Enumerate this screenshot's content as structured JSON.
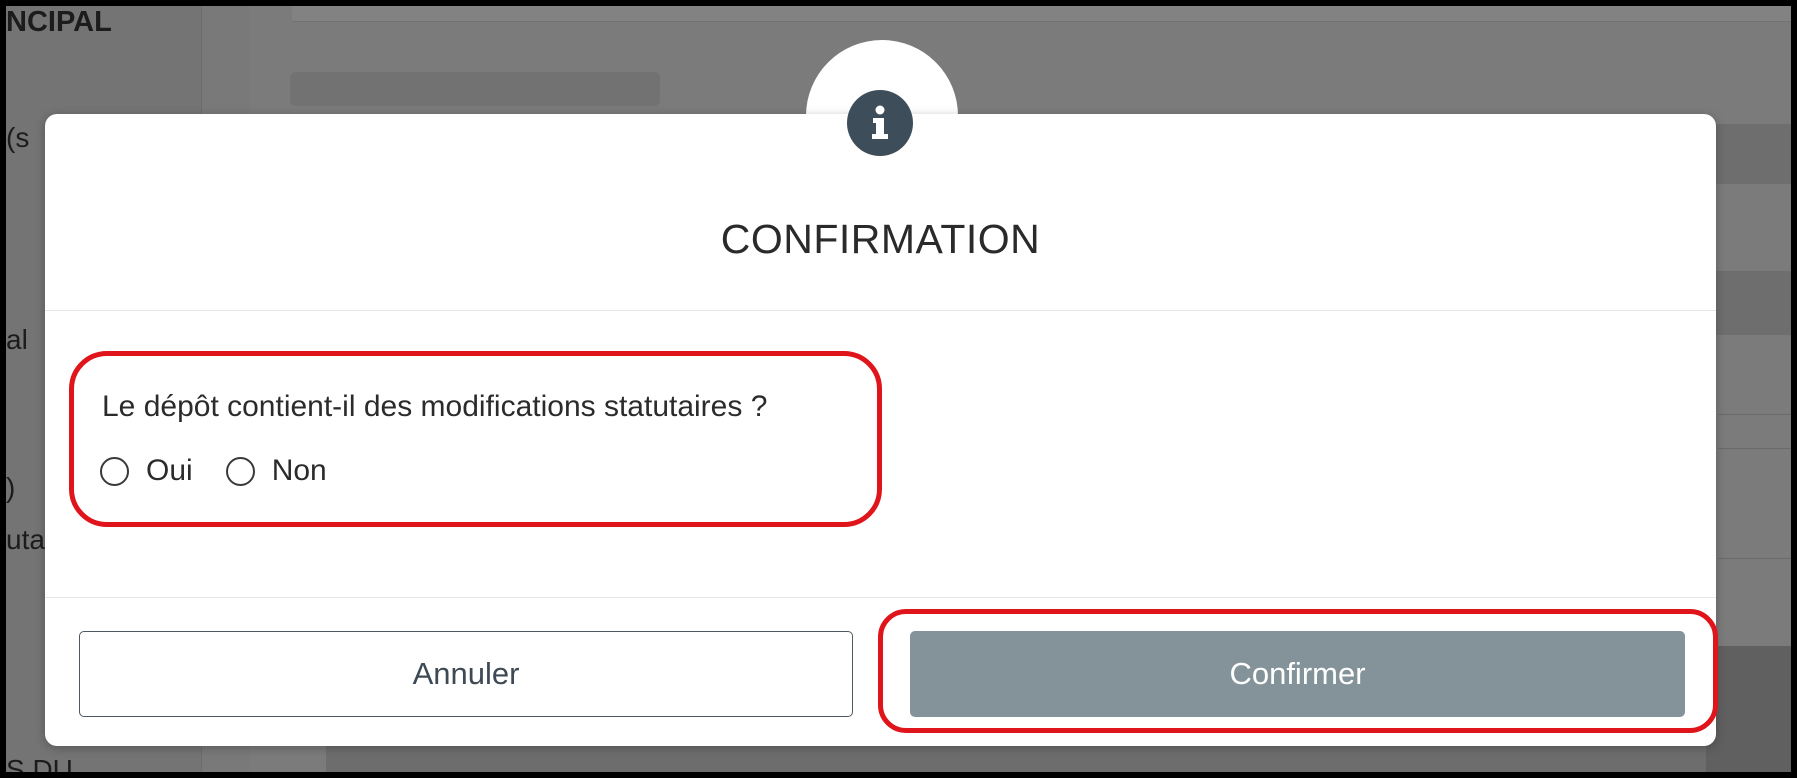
{
  "background": {
    "sidebar_fragments": [
      "NCIPAL",
      "(s",
      "al",
      ")",
      "uta",
      "S DU"
    ]
  },
  "modal": {
    "icon": "info-icon",
    "title": "CONFIRMATION",
    "question": "Le dépôt contient-il des modifications statutaires ?",
    "options": [
      {
        "label": "Oui",
        "selected": false
      },
      {
        "label": "Non",
        "selected": false
      }
    ],
    "buttons": {
      "cancel_label": "Annuler",
      "confirm_label": "Confirmer"
    }
  },
  "colors": {
    "confirm_button": "#849399",
    "info_icon": "#3d4e5a",
    "annotation": "#e0141b"
  }
}
